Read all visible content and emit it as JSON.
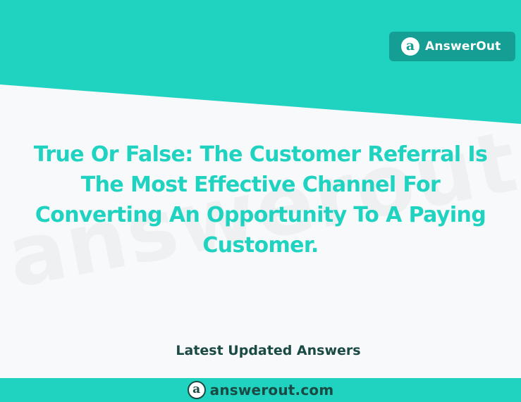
{
  "brand": {
    "name": "AnswerOut",
    "icon": "a-circle-logo-icon",
    "icon_glyph": "a"
  },
  "question": {
    "text": "True Or False: The Customer Referral Is The Most Effective Channel For Converting An Opportunity To A Paying Customer."
  },
  "watermark": {
    "text": "answerout.com"
  },
  "section": {
    "latest_label": "Latest Updated Answers"
  },
  "footer": {
    "site": "answerout.com",
    "icon": "a-circle-logo-icon",
    "icon_glyph": "a"
  },
  "colors": {
    "accent": "#1fd3c0",
    "badge": "#159e93",
    "dark_text": "#1a4a43",
    "background": "#f8f9fb"
  }
}
